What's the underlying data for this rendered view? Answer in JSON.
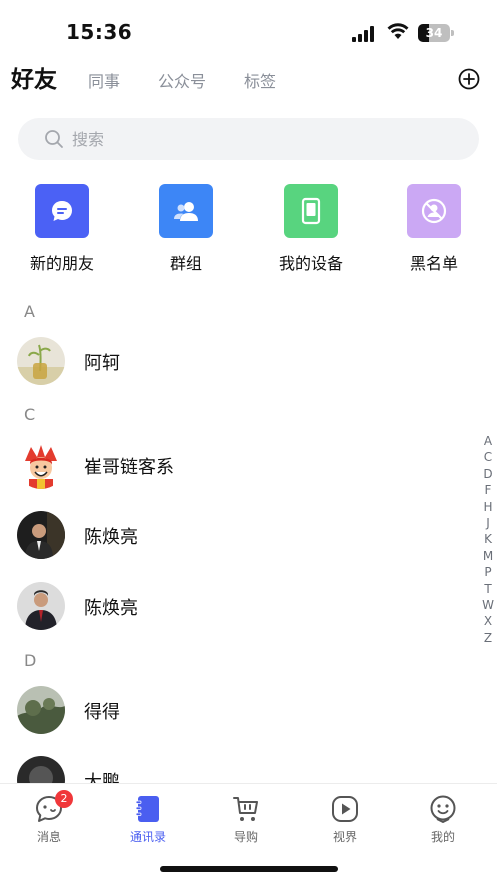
{
  "status_bar": {
    "time": "15:36",
    "battery": "34",
    "battery_percent": 34
  },
  "tabs": [
    {
      "label": "好友",
      "active": true
    },
    {
      "label": "同事",
      "active": false
    },
    {
      "label": "公众号",
      "active": false
    },
    {
      "label": "标签",
      "active": false
    }
  ],
  "search": {
    "placeholder": "搜索",
    "value": ""
  },
  "quick_entries": [
    {
      "label": "新的朋友",
      "icon": "chat-bubble-icon",
      "color": "#4b61f5"
    },
    {
      "label": "群组",
      "icon": "group-icon",
      "color": "#3d86f6"
    },
    {
      "label": "我的设备",
      "icon": "device-icon",
      "color": "#58d47f"
    },
    {
      "label": "黑名单",
      "icon": "block-user-icon",
      "color": "#cba8f4"
    }
  ],
  "sections": [
    {
      "letter": "A",
      "contacts": [
        {
          "name": "阿轲"
        }
      ]
    },
    {
      "letter": "C",
      "contacts": [
        {
          "name": "崔哥链客系"
        },
        {
          "name": "陈焕亮"
        },
        {
          "name": "陈焕亮"
        }
      ]
    },
    {
      "letter": "D",
      "contacts": [
        {
          "name": "得得"
        },
        {
          "name": "大鹏"
        }
      ]
    }
  ],
  "alpha_index": [
    "A",
    "C",
    "D",
    "F",
    "H",
    "J",
    "K",
    "M",
    "P",
    "T",
    "W",
    "X",
    "Z"
  ],
  "bottom_nav": [
    {
      "label": "消息",
      "icon": "message-icon",
      "badge": "2"
    },
    {
      "label": "通讯录",
      "icon": "contacts-book-icon",
      "active": true
    },
    {
      "label": "导购",
      "icon": "shopping-cart-icon"
    },
    {
      "label": "视界",
      "icon": "video-play-icon"
    },
    {
      "label": "我的",
      "icon": "profile-face-icon"
    }
  ],
  "colors": {
    "accent": "#4a5ef0",
    "badge": "#f0373a"
  }
}
